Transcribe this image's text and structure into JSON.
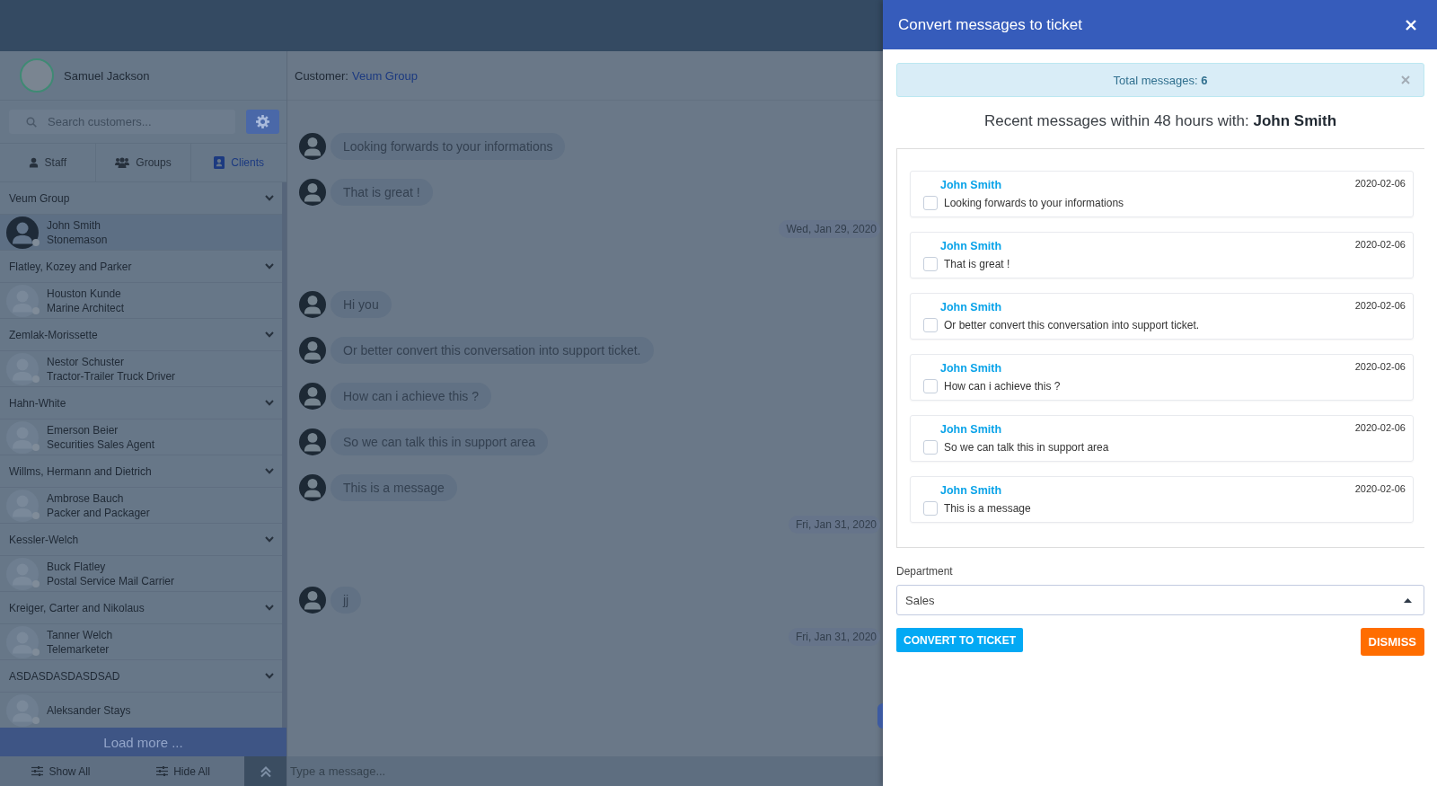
{
  "sidebar": {
    "profile": {
      "name": "Samuel Jackson"
    },
    "search": {
      "placeholder": "Search customers..."
    },
    "tabs": [
      {
        "label": "Staff",
        "selected": false
      },
      {
        "label": "Groups",
        "selected": false
      },
      {
        "label": "Clients",
        "selected": true
      }
    ],
    "groups": [
      {
        "name": "Veum Group",
        "contacts": [
          {
            "name": "John Smith",
            "role": "Stonemason",
            "selected": true
          }
        ]
      },
      {
        "name": "Flatley, Kozey and Parker",
        "contacts": [
          {
            "name": "Houston Kunde",
            "role": "Marine Architect",
            "selected": false
          }
        ]
      },
      {
        "name": "Zemlak-Morissette",
        "contacts": [
          {
            "name": "Nestor Schuster",
            "role": "Tractor-Trailer Truck Driver",
            "selected": false
          }
        ]
      },
      {
        "name": "Hahn-White",
        "contacts": [
          {
            "name": "Emerson Beier",
            "role": "Securities Sales Agent",
            "selected": false
          }
        ]
      },
      {
        "name": "Willms, Hermann and Dietrich",
        "contacts": [
          {
            "name": "Ambrose Bauch",
            "role": "Packer and Packager",
            "selected": false
          }
        ]
      },
      {
        "name": "Kessler-Welch",
        "contacts": [
          {
            "name": "Buck Flatley",
            "role": "Postal Service Mail Carrier",
            "selected": false
          }
        ]
      },
      {
        "name": "Kreiger, Carter and Nikolaus",
        "contacts": [
          {
            "name": "Tanner Welch",
            "role": "Telemarketer",
            "selected": false
          }
        ]
      },
      {
        "name": "ASDASDASDASDSAD",
        "contacts": [
          {
            "name": "Aleksander Stays",
            "selected": false
          }
        ]
      }
    ],
    "load_more": "Load more ...",
    "footer": [
      {
        "label": "Show All"
      },
      {
        "label": "Hide All"
      }
    ]
  },
  "chat": {
    "customer_label": "Customer:",
    "customer": "Veum Group",
    "items": [
      {
        "kind": "message",
        "text": "Looking forwards to your informations"
      },
      {
        "kind": "message",
        "text": "That is great !"
      },
      {
        "kind": "date",
        "text": "Wed, Jan 29, 2020"
      },
      {
        "kind": "message",
        "text": "Hi you"
      },
      {
        "kind": "message",
        "text": "Or better convert this conversation into support ticket."
      },
      {
        "kind": "message",
        "text": "How can i achieve this ?"
      },
      {
        "kind": "message",
        "text": "So we can talk this in support area"
      },
      {
        "kind": "message",
        "text": "This is a message"
      },
      {
        "kind": "date",
        "text": "Fri, Jan 31, 2020"
      },
      {
        "kind": "message",
        "text": "jj"
      },
      {
        "kind": "date",
        "text": "Fri, Jan 31, 2020"
      }
    ],
    "input": {
      "placeholder": "Type a message..."
    }
  },
  "dialog": {
    "title": "Convert messages to ticket",
    "alert": "Total messages: **6**",
    "heading": "Recent messages within 48 hours with: **John Smith**",
    "messages": [
      {
        "sender": "John Smith",
        "date": "2020-02-06",
        "text": "Looking forwards to your informations",
        "checked": false
      },
      {
        "sender": "John Smith",
        "date": "2020-02-06",
        "text": "That is great !",
        "checked": false
      },
      {
        "sender": "John Smith",
        "date": "2020-02-06",
        "text": "Or better convert this conversation into support ticket.",
        "checked": false
      },
      {
        "sender": "John Smith",
        "date": "2020-02-06",
        "text": "How can i achieve this ?",
        "checked": false
      },
      {
        "sender": "John Smith",
        "date": "2020-02-06",
        "text": "So we can talk this in support area",
        "checked": false
      },
      {
        "sender": "John Smith",
        "date": "2020-02-06",
        "text": "This is a message",
        "checked": false
      }
    ],
    "department": {
      "label": "Department",
      "value": "Sales"
    },
    "buttons": [
      {
        "kind": "primary",
        "label": "CONVERT TO TICKET"
      },
      {
        "kind": "danger",
        "label": "DISMISS"
      }
    ]
  }
}
